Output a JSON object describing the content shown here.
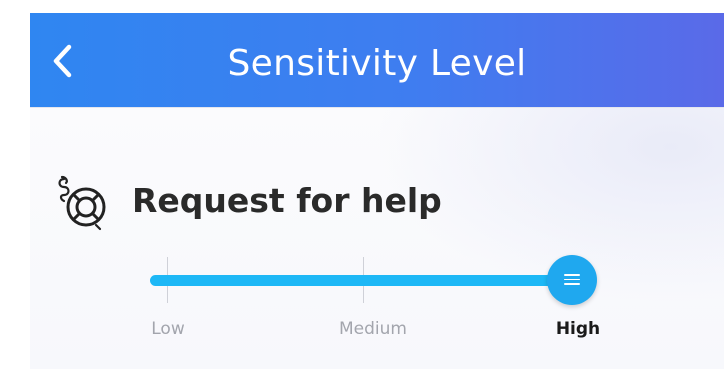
{
  "header": {
    "title": "Sensitivity Level",
    "back_icon": "chevron-left-icon",
    "background": "#3f7df0"
  },
  "section": {
    "icon": "lifebuoy-icon",
    "title": "Request for help"
  },
  "slider": {
    "levels": [
      "Low",
      "Medium",
      "High"
    ],
    "selected": "High",
    "value_fraction": 1.0,
    "accent_color": "#1db8f6"
  }
}
